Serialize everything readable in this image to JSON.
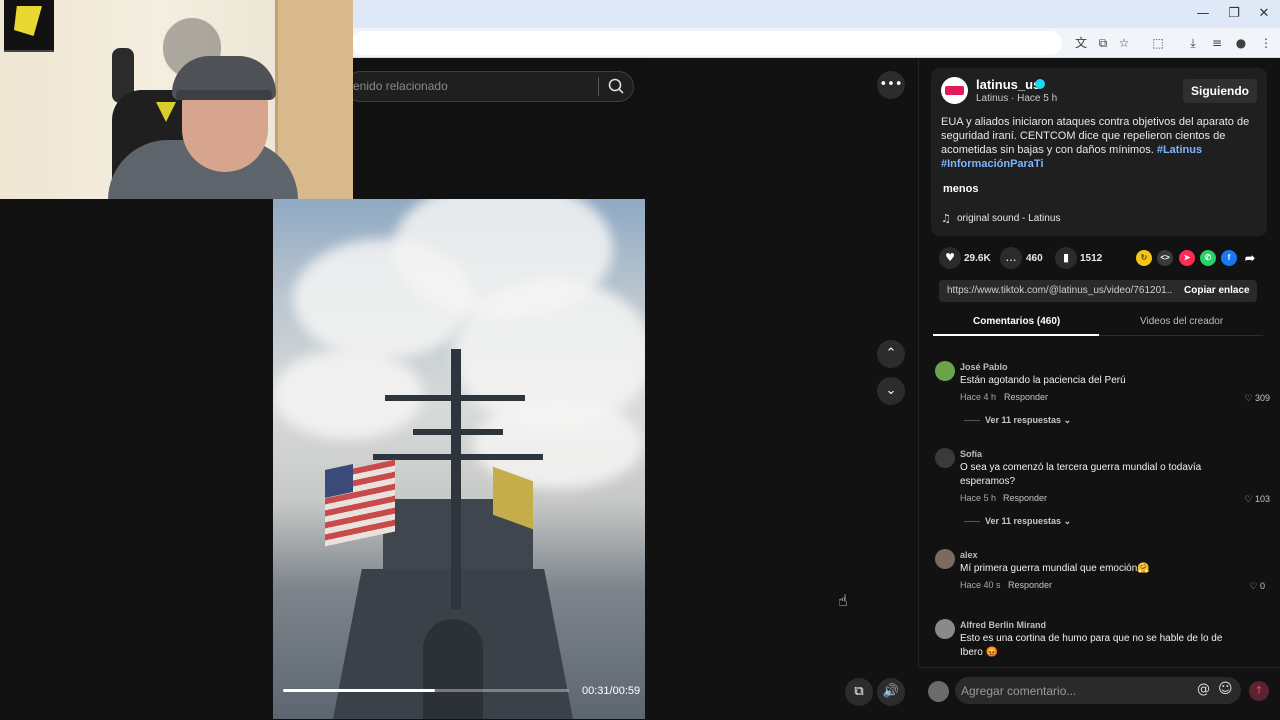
{
  "browser": {
    "window_controls": {
      "minimize": "—",
      "restore": "❐",
      "close": "✕"
    },
    "toolbar_icons": [
      "translate-icon",
      "install-icon",
      "star-icon",
      "extensions-icon",
      "download-icon",
      "media-icon",
      "profile-icon",
      "menu-icon"
    ]
  },
  "feed": {
    "search_placeholder": "enido relacionado",
    "video_time": "00:31/00:59",
    "progress": 0.53,
    "more_label": "•••"
  },
  "post": {
    "username": "latinus_us",
    "subline": "Latinus · Hace 5 h",
    "follow_label": "Siguiendo",
    "description": "EUA y aliados iniciaron ataques contra objetivos del aparato de seguridad iraní. CENTCOM dice que repelieron cientos de acometidas sin bajas y con daños mínimos. ",
    "hashtag1": "#Latinus",
    "hashtag2": "#InformaciónParaTi",
    "less_label": "menos",
    "music": "original sound - Latinus",
    "likes": "29.6K",
    "comments": "460",
    "saves": "1512",
    "link": "https://www.tiktok.com/@latinus_us/video/761201...",
    "copy_label": "Copiar enlace"
  },
  "tabs": {
    "comments": "Comentarios (460)",
    "videos": "Videos del creador"
  },
  "comments": [
    {
      "name": "José Pablo",
      "text": "Están agotando la paciencia del Perú",
      "time": "Hace 4 h",
      "reply": "Responder",
      "likes": "309",
      "more": "Ver 11 respuestas",
      "avatar_color": "#6aa34a"
    },
    {
      "name": "Sofía",
      "text": "O sea ya comenzó la tercera guerra mundial o todavía esperamos?",
      "time": "Hace 5 h",
      "reply": "Responder",
      "likes": "103",
      "more": "Ver 11 respuestas",
      "avatar_color": "#3a3a3a"
    },
    {
      "name": "alex",
      "text": "Mí primera guerra mundial que emoción🤗",
      "time": "Hace 40 s",
      "reply": "Responder",
      "likes": "0",
      "avatar_color": "#7a6a60"
    },
    {
      "name": "Alfred Berlin Mirand",
      "text": "Esto es una cortina de humo para que no se hable de lo de Ibero 😡",
      "time": "",
      "reply": "",
      "likes": "",
      "avatar_color": "#8a8a8a"
    }
  ],
  "comment_input": {
    "placeholder": "Agregar comentario..."
  }
}
